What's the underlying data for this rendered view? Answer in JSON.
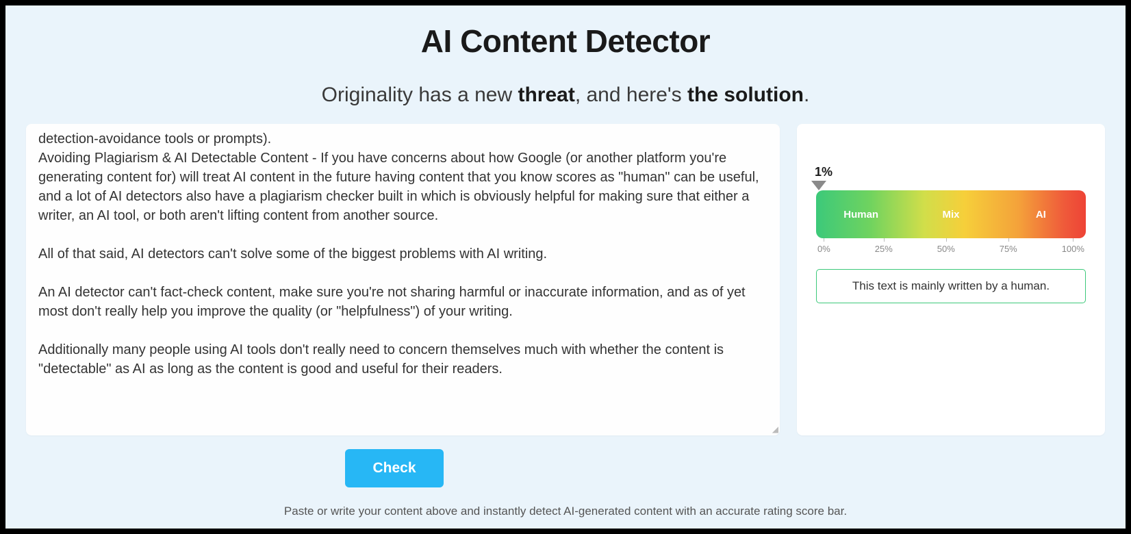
{
  "header": {
    "title": "AI Content Detector",
    "subtitle_pre": "Originality has a new ",
    "subtitle_bold1": "threat",
    "subtitle_mid": ", and here's ",
    "subtitle_bold2": "the solution",
    "subtitle_post": "."
  },
  "editor": {
    "content": "detection-avoidance tools or prompts).\nAvoiding Plagiarism & AI Detectable Content - If you have concerns about how Google (or another platform you're generating content for) will treat AI content in the future having content that you know scores as \"human\" can be useful, and a lot of AI detectors also have a plagiarism checker built in which is obviously helpful for making sure that either a writer, an AI tool, or both aren't lifting content from another source.\n\nAll of that said, AI detectors can't solve some of the biggest problems with AI writing.\n\nAn AI detector can't fact-check content, make sure you're not sharing harmful or inaccurate information, and as of yet most don't really help you improve the quality (or \"helpfulness\") of your writing.\n\nAdditionally many people using AI tools don't really need to concern themselves much with whether the content is \"detectable\" as AI as long as the content is good and useful for their readers."
  },
  "result": {
    "score_percent": "1%",
    "bar_labels": {
      "human": "Human",
      "mix": "Mix",
      "ai": "AI"
    },
    "ticks": {
      "t0": "0%",
      "t25": "25%",
      "t50": "50%",
      "t75": "75%",
      "t100": "100%"
    },
    "message": "This text is mainly written by a human."
  },
  "actions": {
    "check_label": "Check",
    "hint": "Paste or write your content above and instantly detect AI-generated content with an accurate rating score bar."
  }
}
